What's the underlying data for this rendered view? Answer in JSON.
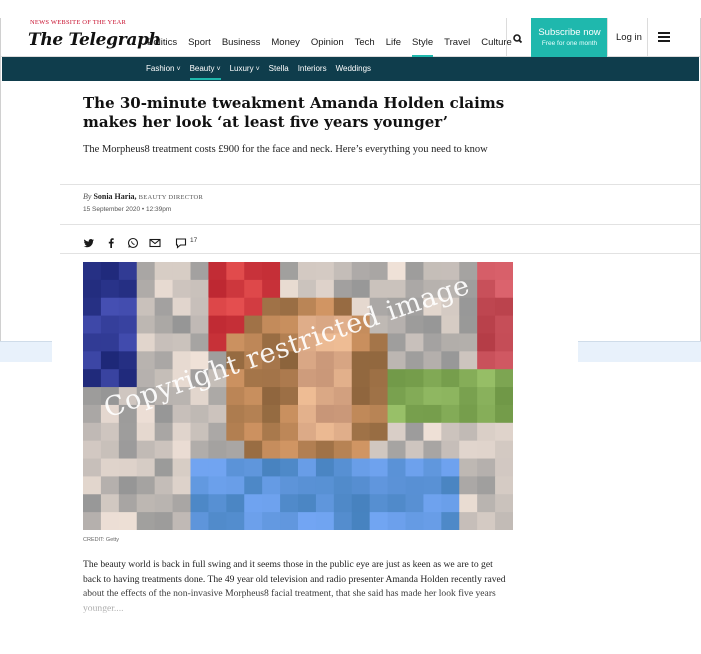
{
  "header": {
    "award": "NEWS WEBSITE OF THE YEAR",
    "logo": "The Telegraph",
    "nav": [
      "Politics",
      "Sport",
      "Business",
      "Money",
      "Opinion",
      "Tech",
      "Life",
      "Style",
      "Travel",
      "Culture"
    ],
    "active_nav": "Style",
    "subscribe_label": "Subscribe now",
    "subscribe_sub": "Free for one month",
    "login_label": "Log in"
  },
  "subnav": {
    "items": [
      {
        "label": "Fashion",
        "chevron": true
      },
      {
        "label": "Beauty",
        "chevron": true
      },
      {
        "label": "Luxury",
        "chevron": true
      },
      {
        "label": "Stella",
        "chevron": false
      },
      {
        "label": "Interiors",
        "chevron": false
      },
      {
        "label": "Weddings",
        "chevron": false
      }
    ],
    "active": "Beauty"
  },
  "article": {
    "headline": "The 30-minute tweakment Amanda Holden claims makes her look ‘at least five years younger’",
    "standfirst": "The Morpheus8 treatment costs £900 for the face and neck. Here’s everything you need to know",
    "byline_prefix": "By",
    "author": "Sonia Haria,",
    "author_role": "BEAUTY DIRECTOR",
    "date": "15 September 2020 • 12:39pm",
    "comment_count": "17",
    "image_watermark": "Copyright restricted image",
    "image_credit": "CREDIT: Getty",
    "body": "The beauty world is back in full swing and it seems those in the public eye are just as keen as we are to get back to having treatments done. The 49 year old television and radio presenter Amanda Holden recently raved about the effects of the non-invasive Morpheus8 facial treatment, that she said has made her look five years younger...."
  },
  "icons": {
    "share": [
      "twitter-icon",
      "facebook-icon",
      "whatsapp-icon",
      "email-icon",
      "comment-icon"
    ],
    "header": [
      "search-icon",
      "menu-icon"
    ]
  },
  "colors": {
    "accent": "#1fb8ad",
    "subnav_bg": "#0f3d4c",
    "award_red": "#c8102e"
  }
}
